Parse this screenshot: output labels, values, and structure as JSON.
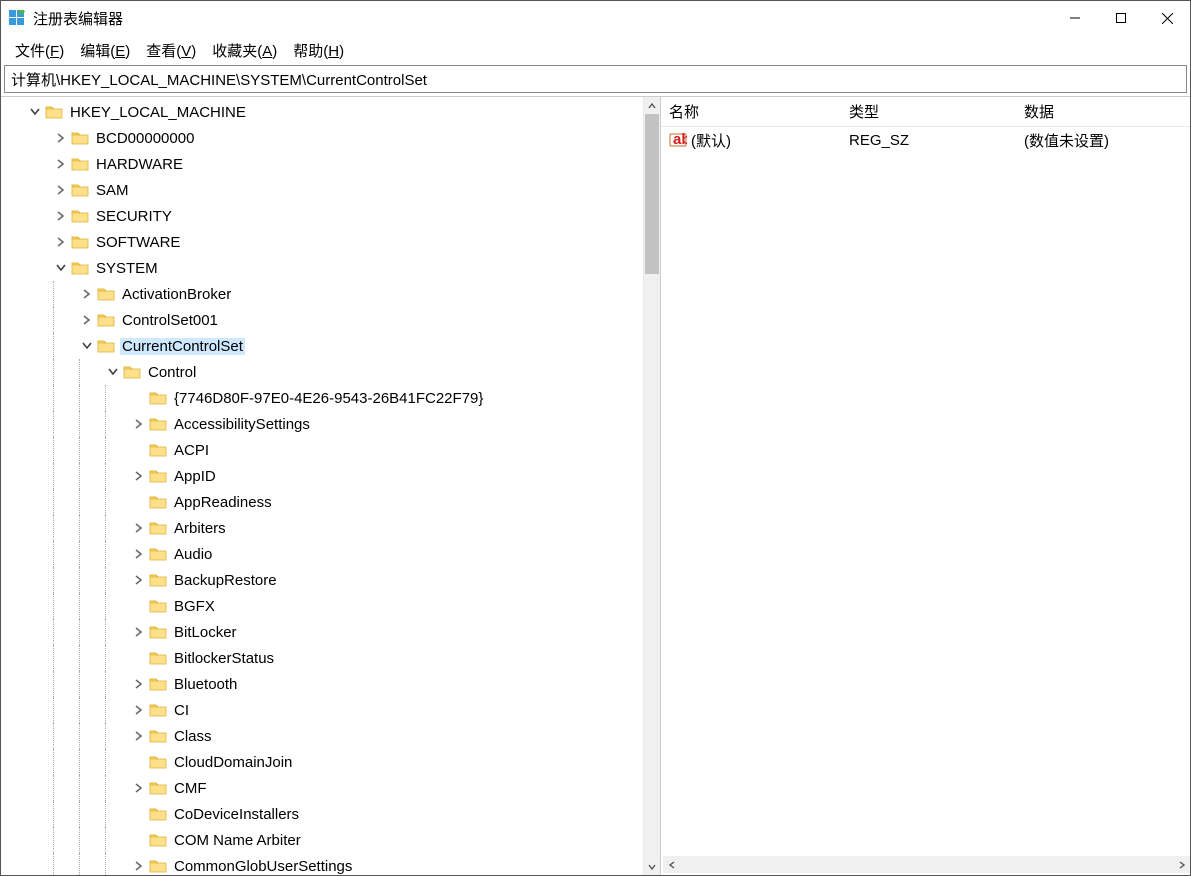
{
  "window": {
    "title": "注册表编辑器"
  },
  "menu": {
    "file": {
      "label": "文件",
      "accel": "F"
    },
    "edit": {
      "label": "编辑",
      "accel": "E"
    },
    "view": {
      "label": "查看",
      "accel": "V"
    },
    "fav": {
      "label": "收藏夹",
      "accel": "A"
    },
    "help": {
      "label": "帮助",
      "accel": "H"
    }
  },
  "address": "计算机\\HKEY_LOCAL_MACHINE\\SYSTEM\\CurrentControlSet",
  "list": {
    "columns": {
      "name": "名称",
      "type": "类型",
      "data": "数据"
    },
    "rows": [
      {
        "name": "(默认)",
        "type": "REG_SZ",
        "data": "(数值未设置)"
      }
    ]
  },
  "tree": [
    {
      "indent": 0,
      "toggle": "open",
      "label": "HKEY_LOCAL_MACHINE",
      "selected": false,
      "guides": [
        0
      ]
    },
    {
      "indent": 1,
      "toggle": "closed",
      "label": "BCD00000000",
      "guides": [
        0,
        0
      ]
    },
    {
      "indent": 1,
      "toggle": "closed",
      "label": "HARDWARE",
      "guides": [
        0,
        0
      ]
    },
    {
      "indent": 1,
      "toggle": "closed",
      "label": "SAM",
      "guides": [
        0,
        0
      ]
    },
    {
      "indent": 1,
      "toggle": "closed",
      "label": "SECURITY",
      "guides": [
        0,
        0
      ]
    },
    {
      "indent": 1,
      "toggle": "closed",
      "label": "SOFTWARE",
      "guides": [
        0,
        0
      ]
    },
    {
      "indent": 1,
      "toggle": "open",
      "label": "SYSTEM",
      "guides": [
        0,
        0
      ]
    },
    {
      "indent": 2,
      "toggle": "closed",
      "label": "ActivationBroker",
      "guides": [
        0,
        1,
        0
      ]
    },
    {
      "indent": 2,
      "toggle": "closed",
      "label": "ControlSet001",
      "guides": [
        0,
        1,
        0
      ]
    },
    {
      "indent": 2,
      "toggle": "open",
      "label": "CurrentControlSet",
      "selected": true,
      "guides": [
        0,
        1,
        0
      ]
    },
    {
      "indent": 3,
      "toggle": "open",
      "label": "Control",
      "guides": [
        0,
        1,
        1,
        0
      ]
    },
    {
      "indent": 4,
      "toggle": "none",
      "label": "{7746D80F-97E0-4E26-9543-26B41FC22F79}",
      "guides": [
        0,
        1,
        1,
        1,
        0
      ]
    },
    {
      "indent": 4,
      "toggle": "closed",
      "label": "AccessibilitySettings",
      "guides": [
        0,
        1,
        1,
        1,
        0
      ]
    },
    {
      "indent": 4,
      "toggle": "none",
      "label": "ACPI",
      "guides": [
        0,
        1,
        1,
        1,
        0
      ]
    },
    {
      "indent": 4,
      "toggle": "closed",
      "label": "AppID",
      "guides": [
        0,
        1,
        1,
        1,
        0
      ]
    },
    {
      "indent": 4,
      "toggle": "none",
      "label": "AppReadiness",
      "guides": [
        0,
        1,
        1,
        1,
        0
      ]
    },
    {
      "indent": 4,
      "toggle": "closed",
      "label": "Arbiters",
      "guides": [
        0,
        1,
        1,
        1,
        0
      ]
    },
    {
      "indent": 4,
      "toggle": "closed",
      "label": "Audio",
      "guides": [
        0,
        1,
        1,
        1,
        0
      ]
    },
    {
      "indent": 4,
      "toggle": "closed",
      "label": "BackupRestore",
      "guides": [
        0,
        1,
        1,
        1,
        0
      ]
    },
    {
      "indent": 4,
      "toggle": "none",
      "label": "BGFX",
      "guides": [
        0,
        1,
        1,
        1,
        0
      ]
    },
    {
      "indent": 4,
      "toggle": "closed",
      "label": "BitLocker",
      "guides": [
        0,
        1,
        1,
        1,
        0
      ]
    },
    {
      "indent": 4,
      "toggle": "none",
      "label": "BitlockerStatus",
      "guides": [
        0,
        1,
        1,
        1,
        0
      ]
    },
    {
      "indent": 4,
      "toggle": "closed",
      "label": "Bluetooth",
      "guides": [
        0,
        1,
        1,
        1,
        0
      ]
    },
    {
      "indent": 4,
      "toggle": "closed",
      "label": "CI",
      "guides": [
        0,
        1,
        1,
        1,
        0
      ]
    },
    {
      "indent": 4,
      "toggle": "closed",
      "label": "Class",
      "guides": [
        0,
        1,
        1,
        1,
        0
      ]
    },
    {
      "indent": 4,
      "toggle": "none",
      "label": "CloudDomainJoin",
      "guides": [
        0,
        1,
        1,
        1,
        0
      ]
    },
    {
      "indent": 4,
      "toggle": "closed",
      "label": "CMF",
      "guides": [
        0,
        1,
        1,
        1,
        0
      ]
    },
    {
      "indent": 4,
      "toggle": "none",
      "label": "CoDeviceInstallers",
      "guides": [
        0,
        1,
        1,
        1,
        0
      ]
    },
    {
      "indent": 4,
      "toggle": "none",
      "label": "COM Name Arbiter",
      "guides": [
        0,
        1,
        1,
        1,
        0
      ]
    },
    {
      "indent": 4,
      "toggle": "closed",
      "label": "CommonGlobUserSettings",
      "guides": [
        0,
        1,
        1,
        1,
        0
      ]
    }
  ]
}
